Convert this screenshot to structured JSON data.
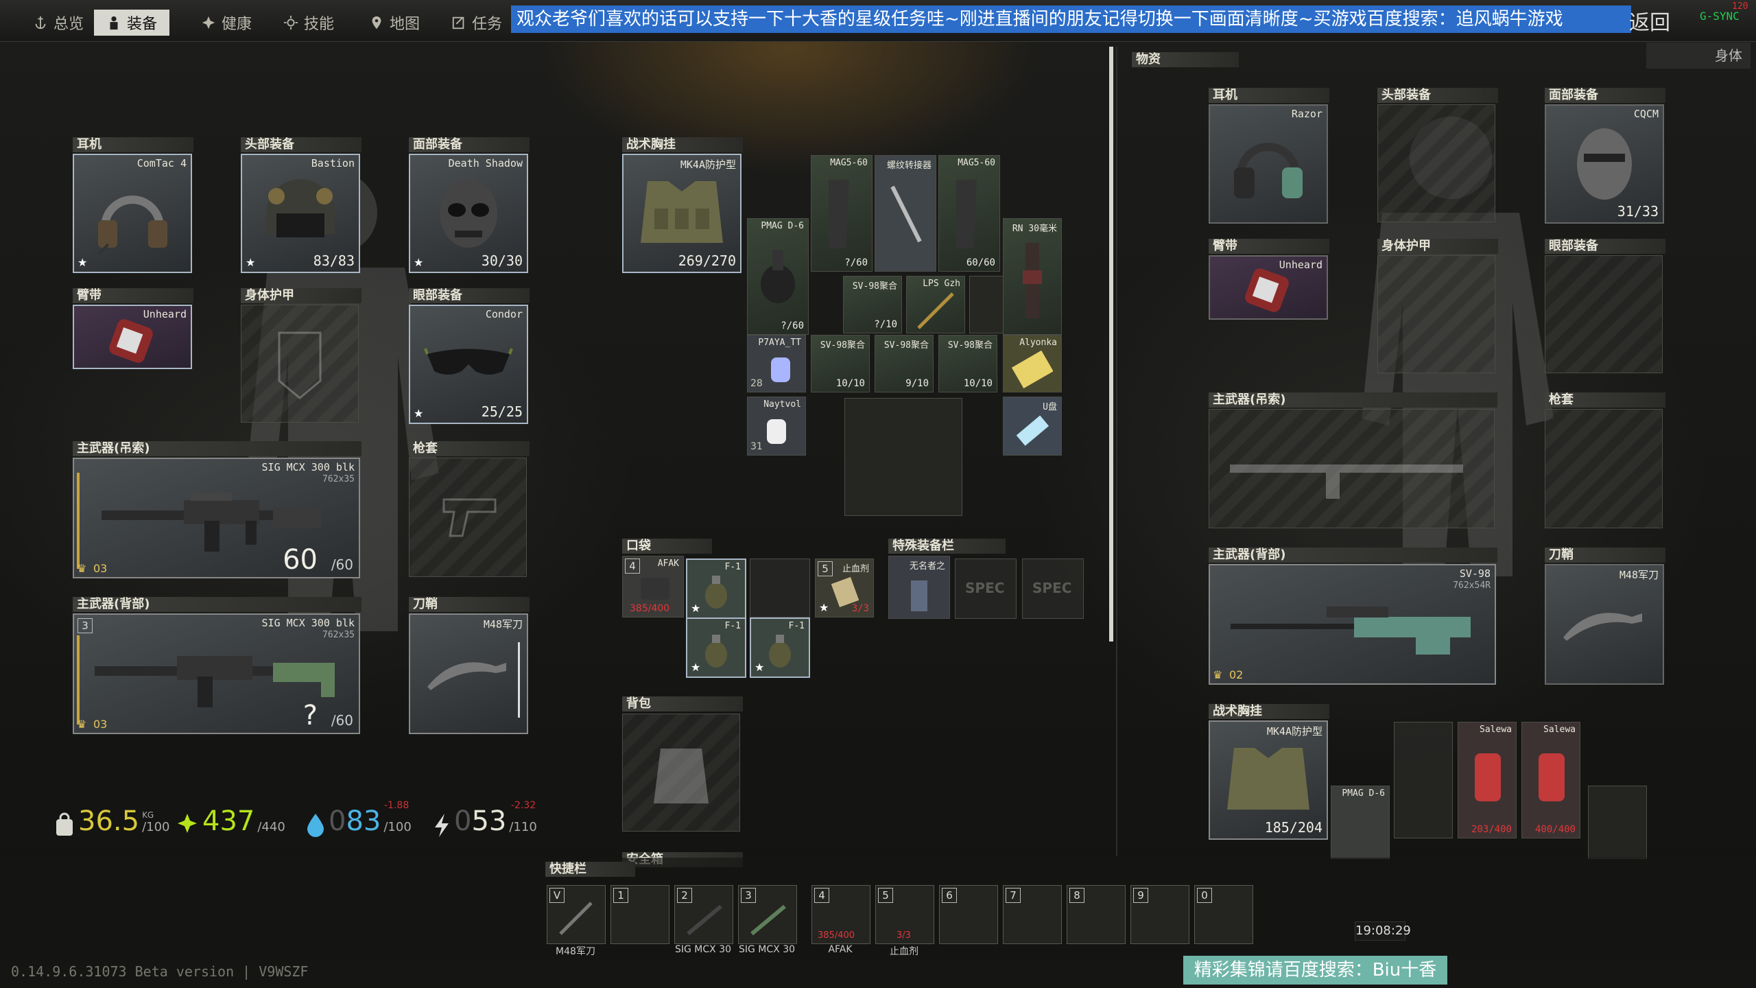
{
  "colors": {
    "banner": "#2b6dc9",
    "promo": "#6fb5a8",
    "health": "#b5e41a",
    "hydration": "#4bb4e6",
    "weight": "#d8c83a"
  },
  "tabs": [
    {
      "label": "总览",
      "icon": "anchor-icon"
    },
    {
      "label": "装备",
      "icon": "person-icon"
    },
    {
      "label": "健康",
      "icon": "health-icon"
    },
    {
      "label": "技能",
      "icon": "skill-icon"
    },
    {
      "label": "地图",
      "icon": "map-pin-icon"
    },
    {
      "label": "任务",
      "icon": "task-icon"
    }
  ],
  "banner": "观众老爷们喜欢的话可以支持一下十大香的星级任务哇~刚进直播间的朋友记得切换一下画面清晰度~买游戏百度搜索：追风蜗牛游戏",
  "back": "返回",
  "gsync": "G-SYNC",
  "fps": "120",
  "left": {
    "slots": {
      "earpiece": {
        "title": "耳机",
        "item": "ComTac 4"
      },
      "headwear": {
        "title": "头部装备",
        "item": "Bastion",
        "dur": "83/83"
      },
      "facecover": {
        "title": "面部装备",
        "item": "Death Shadow",
        "dur": "30/30"
      },
      "armband": {
        "title": "臂带",
        "item": "Unheard"
      },
      "armor": {
        "title": "身体护甲"
      },
      "eyewear": {
        "title": "眼部装备",
        "item": "Condor",
        "dur": "25/25"
      },
      "primary1": {
        "title": "主武器(吊索)",
        "item": "SIG MCX 300 blk",
        "ammo": "762x35",
        "count": "60",
        "max": "/60",
        "level": "03"
      },
      "holster": {
        "title": "枪套"
      },
      "primary2": {
        "title": "主武器(背部)",
        "item": "SIG MCX 300 blk",
        "ammo": "762x35",
        "count": "?",
        "max": "/60",
        "level": "03",
        "hk": "3"
      },
      "scabbard": {
        "title": "刀鞘",
        "item": "M48军刀"
      }
    },
    "stats": {
      "weight": {
        "value": "36.5",
        "unit": "KG",
        "max": "/100"
      },
      "health": {
        "value": "437",
        "max": "/440"
      },
      "hydration": {
        "value": "83",
        "prefix": "0",
        "max": "/100",
        "delta": "-1.88"
      },
      "energy": {
        "value": "53",
        "prefix": "0",
        "max": "/110",
        "delta": "-2.32"
      }
    }
  },
  "middle": {
    "rig": {
      "title": "战术胸挂",
      "item": "MK4A防护型",
      "dur": "269/270"
    },
    "rigItems": [
      {
        "name": "MAG5-60",
        "val": "?/60"
      },
      {
        "name": "螺纹转接器",
        "val": ""
      },
      {
        "name": "MAG5-60",
        "val": "60/60"
      },
      {
        "name": "PMAG D-6",
        "val": "?/60"
      },
      {
        "name": "SV-98聚合",
        "val": "?/10"
      },
      {
        "name": "LPS Gzh",
        "val": ""
      },
      {
        "name": "RN 30毫米",
        "val": ""
      },
      {
        "name": "P7AYA_TT",
        "val": "28"
      },
      {
        "name": "SV-98聚合",
        "val": "10/10"
      },
      {
        "name": "SV-98聚合",
        "val": "9/10"
      },
      {
        "name": "SV-98聚合",
        "val": "10/10"
      },
      {
        "name": "Alyonka",
        "val": ""
      },
      {
        "name": "Naytvol",
        "val": "31"
      },
      {
        "name": "U盘",
        "val": ""
      }
    ],
    "pockets": {
      "title": "口袋",
      "items": [
        {
          "name": "AFAK",
          "val": "385/400",
          "hk": "4"
        },
        {
          "name": "F-1",
          "val": ""
        },
        {
          "name": "F-1",
          "val": ""
        },
        {
          "name": "F-1",
          "val": ""
        },
        {
          "name": "止血剂",
          "val": "3/3",
          "hk": "5"
        }
      ]
    },
    "special": {
      "title": "特殊装备栏",
      "item": "无名者之",
      "spec": "SPEC"
    },
    "backpack": {
      "title": "背包"
    },
    "secure": {
      "title": "安全箱"
    }
  },
  "right": {
    "tabs": {
      "loot": "物资",
      "body": "身体"
    },
    "slots": {
      "earpiece": {
        "title": "耳机",
        "item": "Razor"
      },
      "headwear": {
        "title": "头部装备"
      },
      "facecover": {
        "title": "面部装备",
        "item": "CQCM",
        "dur": "31/33"
      },
      "armband": {
        "title": "臂带",
        "item": "Unheard"
      },
      "armor": {
        "title": "身体护甲"
      },
      "eyewear": {
        "title": "眼部装备"
      },
      "primary1": {
        "title": "主武器(吊索)"
      },
      "holster": {
        "title": "枪套"
      },
      "primary2": {
        "title": "主武器(背部)",
        "item": "SV-98",
        "ammo": "762x54R",
        "level": "02"
      },
      "scabbard": {
        "title": "刀鞘",
        "item": "M48军刀"
      },
      "rig": {
        "title": "战术胸挂",
        "item": "MK4A防护型",
        "dur": "185/204"
      },
      "rigItems": [
        {
          "name": "PMAG D-6",
          "val": ""
        },
        {
          "name": "Salewa",
          "val": "203/400"
        },
        {
          "name": "Salewa",
          "val": "400/400"
        }
      ]
    }
  },
  "hotbar": {
    "title": "快捷栏",
    "keys": [
      {
        "key": "V",
        "label": "M48军刀"
      },
      {
        "key": "1",
        "label": ""
      },
      {
        "key": "2",
        "label": "SIG MCX 30"
      },
      {
        "key": "3",
        "label": "SIG MCX 30"
      },
      {
        "key": "4",
        "label": "AFAK",
        "val": "385/400"
      },
      {
        "key": "5",
        "label": "止血剂",
        "val": "3/3"
      },
      {
        "key": "6",
        "label": ""
      },
      {
        "key": "7",
        "label": ""
      },
      {
        "key": "8",
        "label": ""
      },
      {
        "key": "9",
        "label": ""
      },
      {
        "key": "0",
        "label": ""
      }
    ]
  },
  "clock": "19:08:29",
  "version": "0.14.9.6.31073 Beta version | V9WSZF",
  "promo": "精彩集锦请百度搜索：Biu十香"
}
